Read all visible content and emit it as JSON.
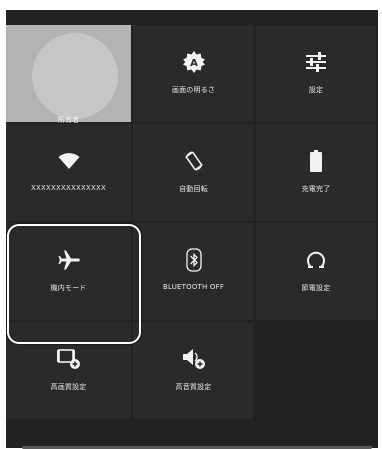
{
  "tiles": {
    "owner": {
      "label": "所有者"
    },
    "brightness": {
      "label": "画面の明るさ",
      "icon_letter": "A"
    },
    "settings": {
      "label": "設定"
    },
    "wifi": {
      "label": "XXXXXXXXXXXXXXX"
    },
    "auto_rotate": {
      "label": "自動回転"
    },
    "battery": {
      "label": "充電完了"
    },
    "airplane": {
      "label": "機内モード"
    },
    "bluetooth": {
      "label": "BLUETOOTH OFF"
    },
    "power_saving": {
      "label": "節電設定"
    },
    "hq_video": {
      "label": "高画質設定"
    },
    "hq_audio": {
      "label": "高音質設定"
    }
  },
  "colors": {
    "panel_bg": "#222222",
    "tile_bg": "#2a2a2a",
    "owner_bg": "#b3b3b3",
    "highlight": "#ffffff",
    "icon": "#f2f2f2"
  }
}
